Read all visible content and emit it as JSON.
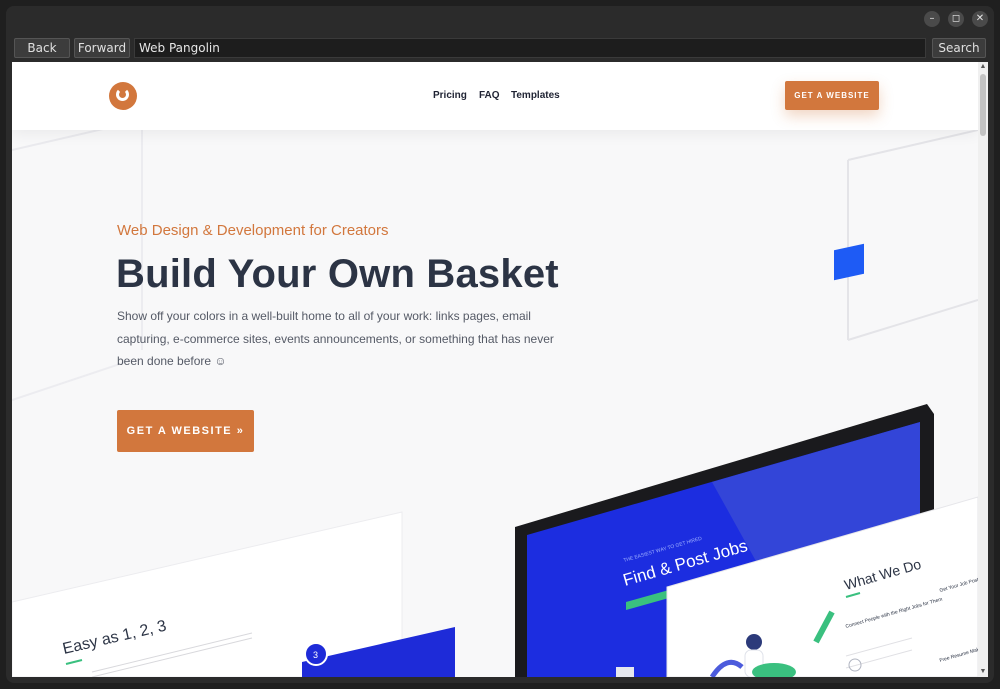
{
  "window": {
    "controls": {
      "minimize": "–",
      "maximize": "◻",
      "close": "✕"
    }
  },
  "toolbar": {
    "back": "Back",
    "forward": "Forward",
    "address": "Web Pangolin",
    "search": "Search"
  },
  "site": {
    "nav": [
      "Pricing",
      "FAQ",
      "Templates"
    ],
    "header_cta": "GET A WEBSITE"
  },
  "hero": {
    "kicker": "Web Design & Development for Creators",
    "title": "Build Your Own Basket",
    "description": "Show off your colors in a well-built home to all of your work: links pages, email capturing, e-commerce sites, events announcements, or something that has never been done before ☺",
    "cta": "GET A WEBSITE »"
  },
  "mockups": {
    "easy_title": "Easy as 1, 2, 3",
    "step_number": "3",
    "jobs_kicker": "THE EASIEST WAY TO GET HIRED",
    "jobs_title": "Find & Post Jobs",
    "what_we_do": "What We Do",
    "connect_people": "Connect People with the Right Jobs for Them",
    "get_your_job": "Get Your Job Posted Company Job Offers",
    "free_resume": "Free Resume Makeovers"
  },
  "colors": {
    "accent": "#d2773d",
    "heading": "#2c3445",
    "blue": "#1e5bf5"
  }
}
